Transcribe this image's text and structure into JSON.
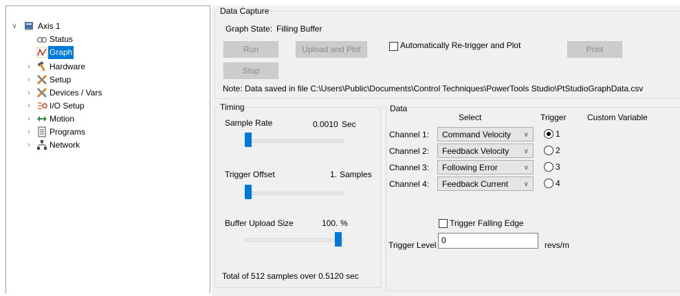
{
  "tree": {
    "root": {
      "label": "Axis 1",
      "icon": "drive-icon"
    },
    "items": [
      {
        "label": "Status",
        "icon": "status-icon"
      },
      {
        "label": "Graph",
        "icon": "graph-icon",
        "selected": true
      },
      {
        "label": "Hardware",
        "icon": "hammer-icon"
      },
      {
        "label": "Setup",
        "icon": "tools-icon"
      },
      {
        "label": "Devices / Vars",
        "icon": "tools-icon"
      },
      {
        "label": "I/O Setup",
        "icon": "io-icon"
      },
      {
        "label": "Motion",
        "icon": "arrows-icon"
      },
      {
        "label": "Programs",
        "icon": "document-icon"
      },
      {
        "label": "Network",
        "icon": "network-icon"
      }
    ]
  },
  "data_capture": {
    "title": "Data Capture",
    "graph_state_label": "Graph State:",
    "graph_state_value": "Filling Buffer",
    "run_label": "Run",
    "upload_label": "Upload and Plot",
    "auto_retrigger_label": "Automatically Re-trigger and Plot",
    "auto_retrigger_checked": false,
    "print_label": "Print",
    "stop_label": "Stop",
    "note": "Note: Data saved in file C:\\Users\\Public\\Documents\\Control Techniques\\PowerTools Studio\\PtStudioGraphData.csv"
  },
  "timing": {
    "title": "Timing",
    "sample_rate_label": "Sample Rate",
    "sample_rate_value": "0.0010",
    "sample_rate_unit": "Sec",
    "trigger_offset_label": "Trigger Offset",
    "trigger_offset_value": "1.",
    "trigger_offset_unit": "Samples",
    "buffer_label": "Buffer Upload Size",
    "buffer_value": "100.",
    "buffer_unit": "%",
    "total_text": "Total of 512 samples over 0.5120 sec"
  },
  "data": {
    "title": "Data",
    "headers": {
      "select": "Select",
      "trigger": "Trigger",
      "custom": "Custom Variable"
    },
    "channels": [
      {
        "label": "Channel 1:",
        "value": "Command Velocity",
        "trigger": "1",
        "selected": true
      },
      {
        "label": "Channel 2:",
        "value": "Feedback Velocity",
        "trigger": "2",
        "selected": false
      },
      {
        "label": "Channel 3:",
        "value": "Following Error",
        "trigger": "3",
        "selected": false
      },
      {
        "label": "Channel 4:",
        "value": "Feedback Current",
        "trigger": "4",
        "selected": false
      }
    ],
    "falling_edge_label": "Trigger Falling Edge",
    "falling_edge_checked": false,
    "trigger_level_label": "Trigger Level",
    "trigger_level_value": "0",
    "trigger_level_unit": "revs/m"
  },
  "colors": {
    "accent": "#0078d7",
    "panel": "#f0f0f0"
  }
}
